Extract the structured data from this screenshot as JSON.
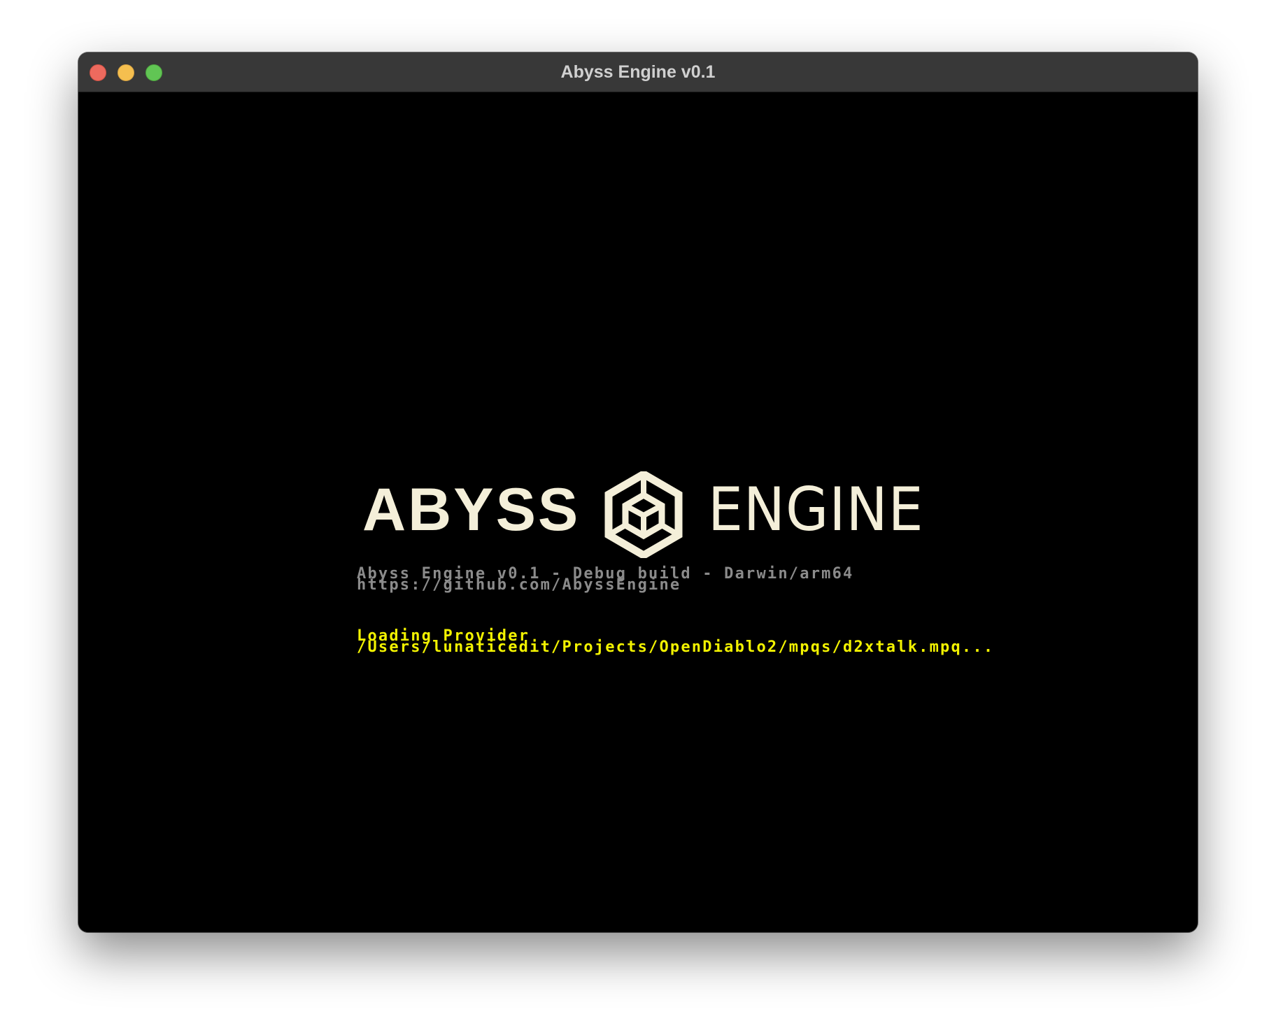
{
  "window": {
    "title": "Abyss Engine v0.1"
  },
  "splash": {
    "logo_left": "ABYSS",
    "logo_right": "ENGINE",
    "logo_icon": "hexagon-cube-icon",
    "build_info": "Abyss Engine v0.1 - Debug build - Darwin/arm64",
    "repo_url": "https://github.com/AbyssEngine",
    "loading_label": "Loading Provider",
    "loading_path": "/Users/lunaticedit/Projects/OpenDiablo2/mpqs/d2xtalk.mpq..."
  },
  "colors": {
    "logo": "#f4efd9",
    "info_text": "#8b8b8b",
    "loading_text": "#f2f200",
    "titlebar": "#383838"
  }
}
